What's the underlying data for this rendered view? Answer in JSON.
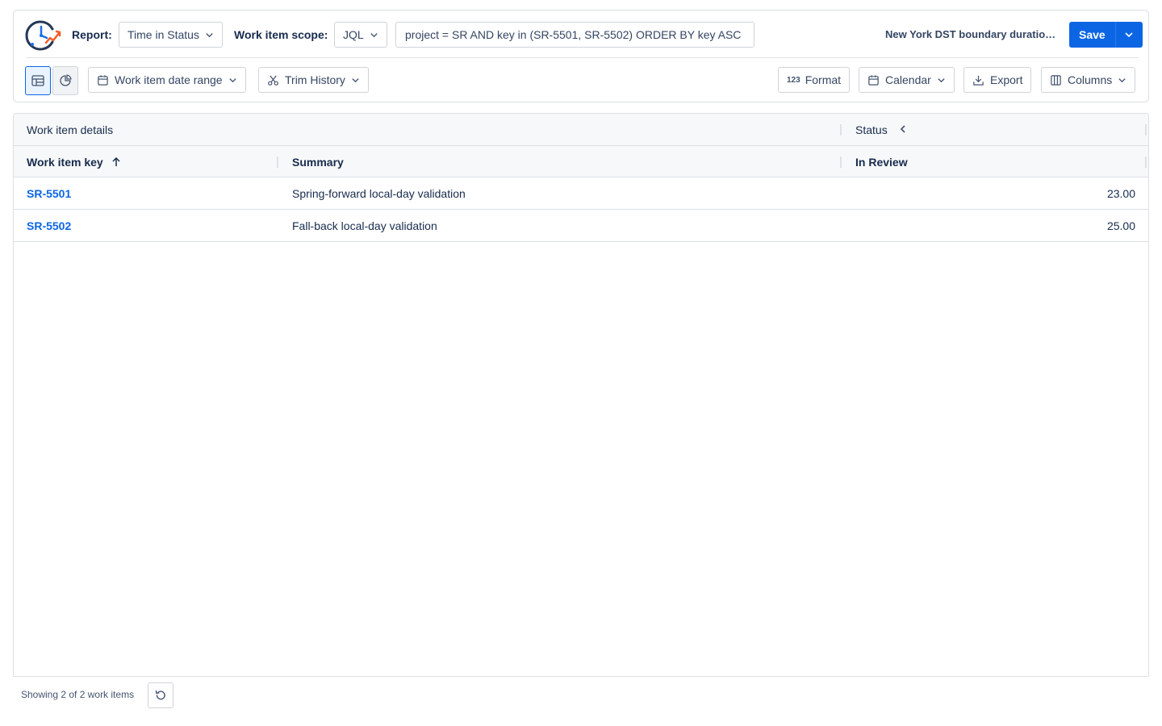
{
  "header": {
    "report_label": "Report:",
    "report_type": "Time in Status",
    "scope_label": "Work item scope:",
    "scope_type": "JQL",
    "jql_value": "project = SR AND key in (SR-5501, SR-5502) ORDER BY key ASC",
    "report_name": "New York DST boundary duration check",
    "save_label": "Save"
  },
  "toolbar": {
    "date_range_label": "Work item date range",
    "trim_history_label": "Trim History",
    "format_label": "Format",
    "calendar_label": "Calendar",
    "export_label": "Export",
    "columns_label": "Columns",
    "format_icon_text": "123"
  },
  "table": {
    "group_headers": {
      "details": "Work item details",
      "status": "Status"
    },
    "columns": {
      "key": "Work item key",
      "summary": "Summary",
      "in_review": "In Review"
    },
    "rows": [
      {
        "key": "SR-5501",
        "summary": "Spring-forward local-day validation",
        "in_review": "23.00"
      },
      {
        "key": "SR-5502",
        "summary": "Fall-back local-day validation",
        "in_review": "25.00"
      }
    ]
  },
  "footer": {
    "showing": "Showing 2 of 2 work items"
  },
  "colors": {
    "accent": "#0c66e4",
    "border": "#dcdfe4",
    "header_bg": "#f7f8f9",
    "logo_orange": "#f0602a"
  }
}
